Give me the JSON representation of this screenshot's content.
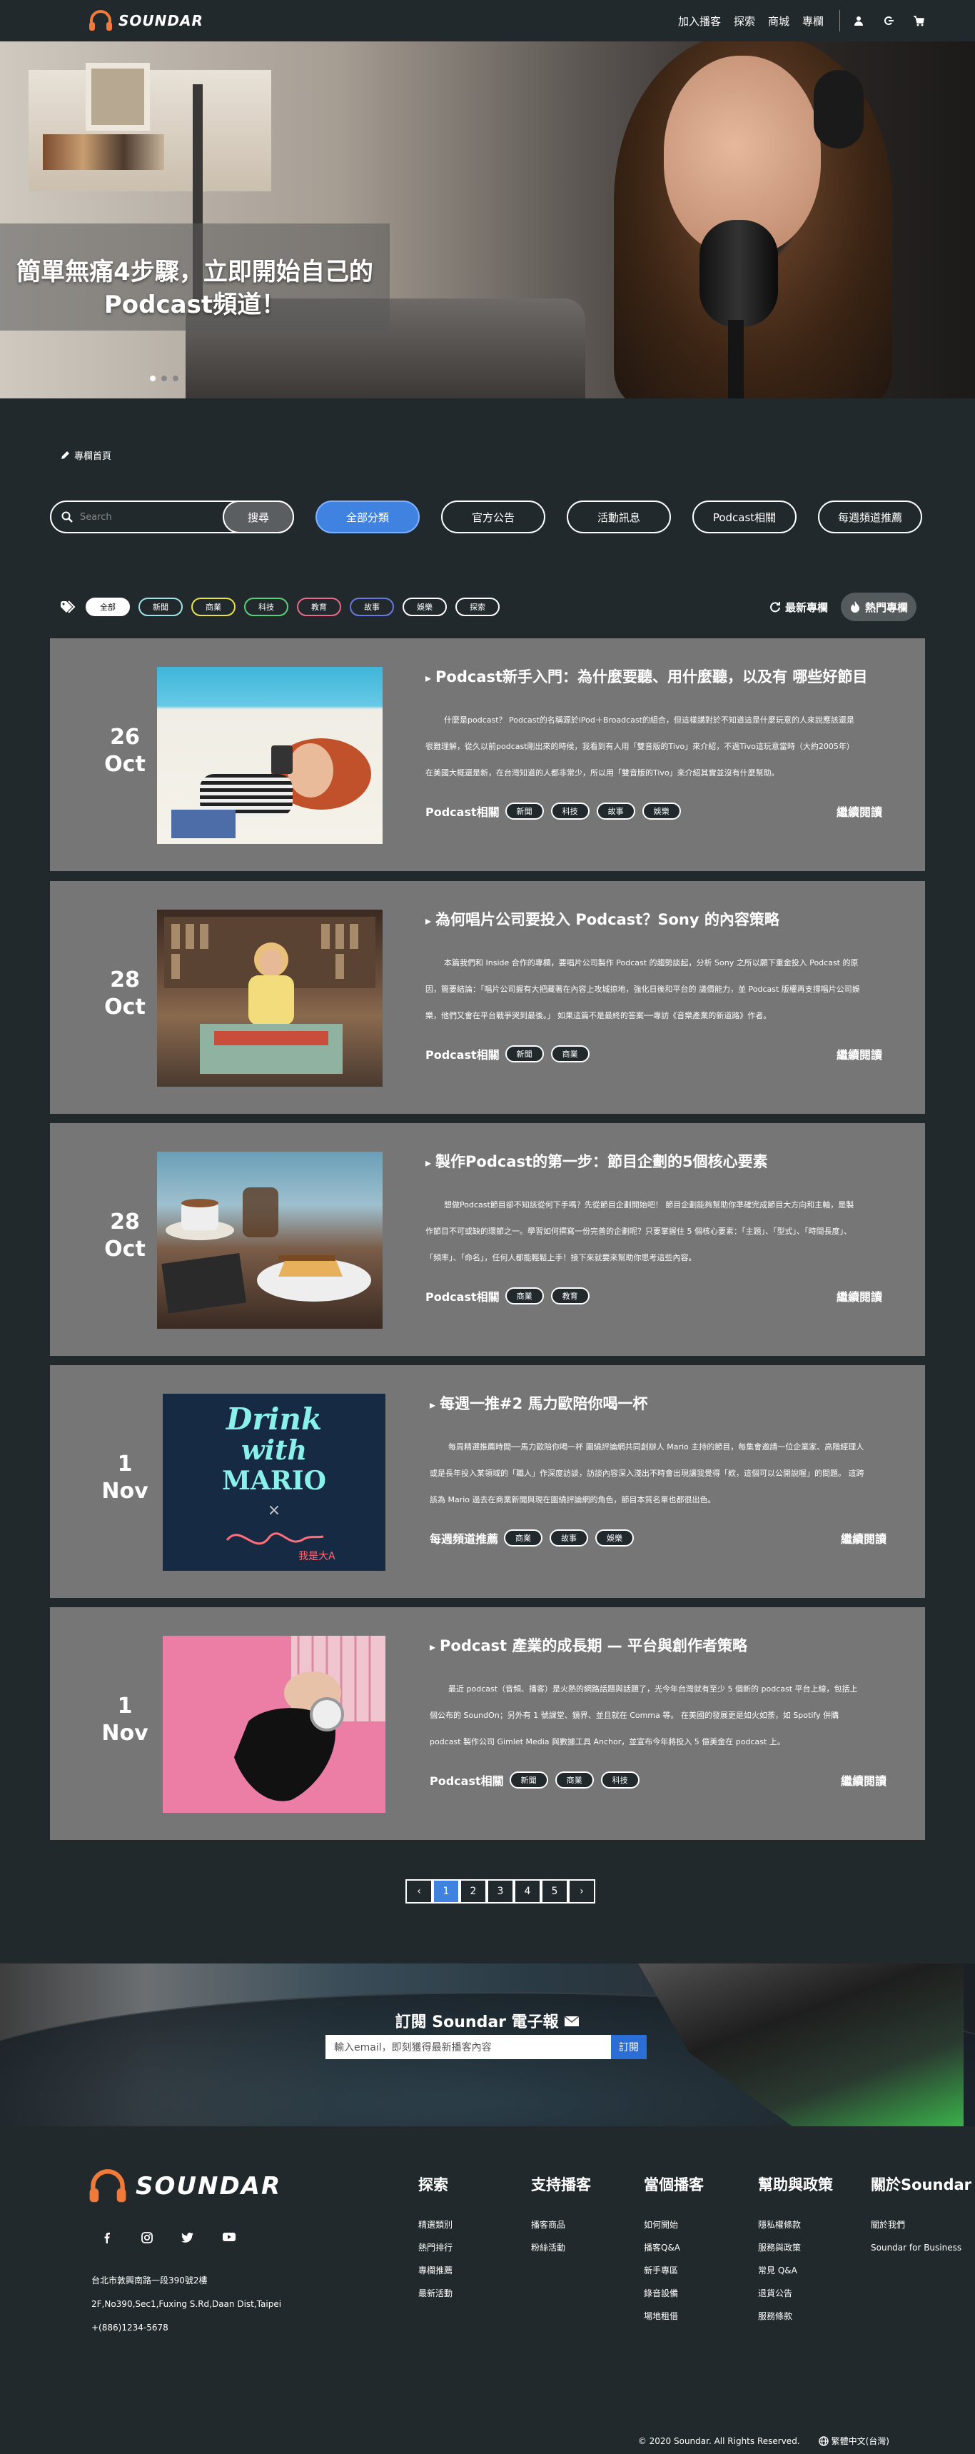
{
  "brand": {
    "name": "SOUNDAR"
  },
  "nav": {
    "links": [
      "加入播客",
      "探索",
      "商城",
      "專欄"
    ],
    "icons": [
      "user-icon",
      "logout-icon",
      "cart-icon"
    ]
  },
  "hero": {
    "title_line1": "簡單無痛4步驟，立即開始自己的",
    "title_line2": "Podcast頻道！",
    "slides": 3,
    "active_slide": 0
  },
  "breadcrumb": {
    "label": "專欄首頁"
  },
  "search": {
    "placeholder": "Search",
    "button": "搜尋"
  },
  "filters": [
    "全部分類",
    "官方公告",
    "活動訊息",
    "Podcast相關",
    "每週頻道推薦"
  ],
  "filter_active": "全部分類",
  "tags": [
    {
      "label": "全部",
      "color": "#ffffff",
      "active": true
    },
    {
      "label": "新聞",
      "color": "#9ee3e8"
    },
    {
      "label": "商業",
      "color": "#e8e24a"
    },
    {
      "label": "科技",
      "color": "#58d07a"
    },
    {
      "label": "教育",
      "color": "#e86b8a"
    },
    {
      "label": "故事",
      "color": "#6a78e0"
    },
    {
      "label": "娛樂",
      "color": "#ffffff"
    },
    {
      "label": "探索",
      "color": "#ffffff"
    }
  ],
  "sort": {
    "latest": "最新專欄",
    "hot": "熱門專欄"
  },
  "articles": [
    {
      "day": "26",
      "month": "Oct",
      "title": "Podcast新手入門：為什麼要聽、用什麼聽，以及有 哪些好節目",
      "excerpt": "什麼是podcast？ Podcast的名稱源於iPod＋Broadcast的組合，但這樣講對於不知道這是什麼玩意的人來說應該還是很難理解，從久以前podcast剛出來的時候，我看到有人用「雙音版的Tivo」來介紹，不過Tivo這玩意當時（大約2005年）在美國大概還是新，在台灣知道的人都非常少，所以用「雙音版的Tivo」來介紹其實並沒有什麼幫助。",
      "category": "Podcast相關",
      "tags": [
        "新聞",
        "科技",
        "故事",
        "娛樂"
      ],
      "more": "繼續閱讀"
    },
    {
      "day": "28",
      "month": "Oct",
      "title": "為何唱片公司要投入 Podcast？Sony 的內容策略",
      "excerpt": "本篇我們和 Inside 合作的專欄，要唱片公司製作 Podcast 的趨勢談起，分析 Sony 之所以願下重金投入 Podcast 的原因，簡要結論：「唱片公司握有大把藏著在內容上攻城掠地，強化日後和平台的 議價能力，並 Podcast 版權再支撐唱片公司娛樂，他們又會在平台戰爭哭到最後。」 如果這篇不是最終的答案──專訪《音樂產業的新道路》作者。",
      "category": "Podcast相關",
      "tags": [
        "新聞",
        "商業"
      ],
      "more": "繼續閱讀"
    },
    {
      "day": "28",
      "month": "Oct",
      "title": "製作Podcast的第一步：節目企劃的5個核心要素",
      "excerpt": "想做Podcast節目卻不知該從何下手嗎？先從節目企劃開始吧！ 節目企劃能夠幫助你準確完成節目大方向和主軸，是製作節目不可或缺的環節之一。學習如何撰寫一份完善的企劃呢？只要掌握住 5 個核心要素：「主題」、「型式」、「時間長度」、「頻率」、「命名」，任何人都能輕鬆上手！接下來就要來幫助你思考這些內容。",
      "category": "Podcast相關",
      "tags": [
        "商業",
        "教育"
      ],
      "more": "繼續閱讀"
    },
    {
      "day": "1",
      "month": "Nov",
      "title": "每週一推#2 馬力歐陪你喝一杯",
      "excerpt": "每周精選推薦時間──馬力歐陪你喝一杯 圍繞評論網共同創辦人 Mario 主持的節目，每集會邀請一位企業家、高階經理人或是長年投入某領域的「職人」作深度訪談，訪談內容深入淺出不時會出現讓我覺得「欸，這個可以公開說喔」的問題。 這跨該為 Mario 過去在商業新聞與現在圍繞評論網的角色，節目本質名單也都很出色。",
      "category": "每週頻道推薦",
      "tags": [
        "商業",
        "故事",
        "娛樂"
      ],
      "more": "繼續閱讀"
    },
    {
      "day": "1",
      "month": "Nov",
      "title": "Podcast 產業的成長期 — 平台與創作者策略",
      "excerpt": "最近 podcast（音頻、播客）是火熱的網路話題與話題了，光今年台灣就有至少 5 個新的 podcast 平台上線，包括上個公布的 SoundOn；另外有 1 號課堂、鏡界、並且就在 Comma 等。 在美國的發展更是如火如荼，如 Spotify 併購 podcast 製作公司 Gimlet Media 與數據工具 Anchor，並宣布今年將投入 5 億美金在 podcast 上。",
      "category": "Podcast相關",
      "tags": [
        "新聞",
        "商業",
        "科技"
      ],
      "more": "繼續閱讀"
    }
  ],
  "pagination": {
    "prev": "‹",
    "pages": [
      "1",
      "2",
      "3",
      "4",
      "5"
    ],
    "current": "1",
    "next": "›"
  },
  "newsletter": {
    "title": "訂閱 Soundar 電子報",
    "placeholder": "輸入email，即刻獲得最新播客內容",
    "button": "訂閱"
  },
  "footer": {
    "address": [
      "台北市敦興南路一段390號2樓",
      "2F,No390,Sec1,Fuxing S.Rd,Daan Dist,Taipei",
      "+(886)1234-5678"
    ],
    "social": [
      "facebook-icon",
      "instagram-icon",
      "twitter-icon",
      "youtube-icon"
    ],
    "columns": [
      {
        "title": "探索",
        "items": [
          "精選類別",
          "熱門排行",
          "專欄推薦",
          "最新活動"
        ]
      },
      {
        "title": "支持播客",
        "items": [
          "播客商品",
          "粉絲活動"
        ]
      },
      {
        "title": "當個播客",
        "items": [
          "如何開始",
          "播客Q&A",
          "新手專區",
          "錄音設備",
          "場地租借"
        ]
      },
      {
        "title": "幫助與政策",
        "items": [
          "隱私權條款",
          "服務與政策",
          "常見 Q&A",
          "退貨公告",
          "服務條款"
        ]
      },
      {
        "title": "關於Soundar",
        "items": [
          "關於我們",
          "Soundar for Business"
        ]
      }
    ],
    "copyright": "© 2020 Soundar. All Rights Reserved.",
    "language": "繁體中文(台灣)"
  },
  "colors": {
    "background": "#22292c",
    "card": "#767676",
    "accent": "#3f82e0",
    "logo": "#f07a3a"
  }
}
